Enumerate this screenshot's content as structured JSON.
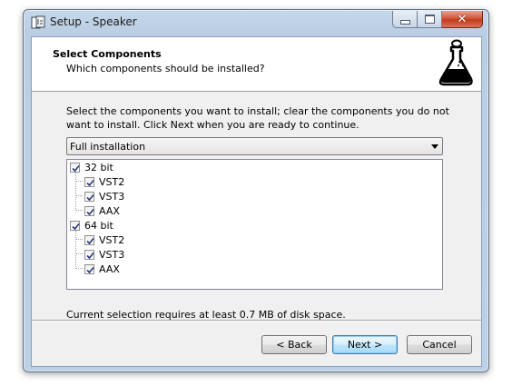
{
  "window": {
    "title": "Setup - Speaker"
  },
  "header": {
    "title": "Select Components",
    "subtitle": "Which components should be installed?"
  },
  "instructions": "Select the components you want to install; clear the components you do not want to install. Click Next when you are ready to continue.",
  "install_type": {
    "selected": "Full installation"
  },
  "components": {
    "group1": {
      "label": "32 bit",
      "checked": true
    },
    "g1_vst2": {
      "label": "VST2",
      "checked": true
    },
    "g1_vst3": {
      "label": "VST3",
      "checked": true
    },
    "g1_aax": {
      "label": "AAX",
      "checked": true
    },
    "group2": {
      "label": "64 bit",
      "checked": true
    },
    "g2_vst2": {
      "label": "VST2",
      "checked": true
    },
    "g2_vst3": {
      "label": "VST3",
      "checked": true
    },
    "g2_aax": {
      "label": "AAX",
      "checked": true
    }
  },
  "disk_space": "Current selection requires at least 0.7 MB of disk space.",
  "buttons": {
    "back": "< Back",
    "next": "Next >",
    "cancel": "Cancel"
  },
  "icons": {
    "app": "setup-app-icon",
    "header": "flask-icon",
    "check": "check-icon"
  }
}
